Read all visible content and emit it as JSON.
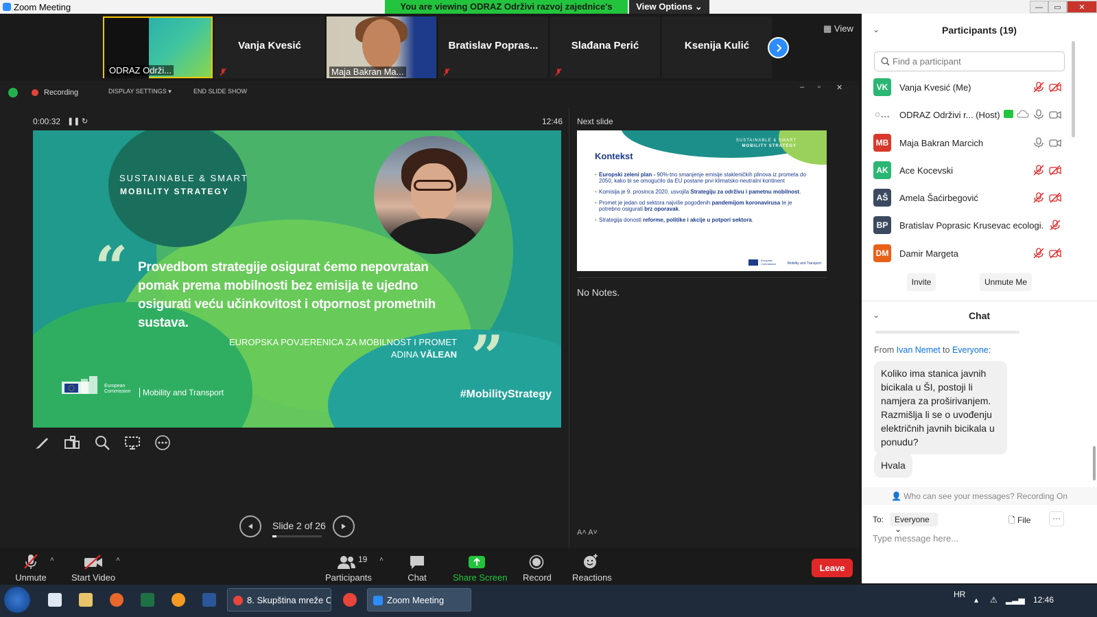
{
  "window": {
    "title": "Zoom Meeting",
    "viewing_banner": "You are viewing ODRAZ Održivi razvoj zajednice's screen",
    "view_options": "View Options ⌄",
    "controls": [
      "—",
      "▭",
      "✕"
    ]
  },
  "thumbnails": [
    {
      "name": "",
      "label": "ODRAZ Održi...",
      "active": true
    },
    {
      "name": "Vanja Kvesić",
      "label": ""
    },
    {
      "name": "",
      "label": "Maja Bakran Ma..."
    },
    {
      "name": "Bratislav  Popras...",
      "label": ""
    },
    {
      "name": "Slađana Perić",
      "label": ""
    },
    {
      "name": "Ksenija Kulić",
      "label": ""
    }
  ],
  "view_button": "View",
  "presenter": {
    "recording": "Recording",
    "display_settings": "DISPLAY SETTINGS ▾",
    "end_slide_show": "END SLIDE SHOW",
    "elapsed": "0:00:32",
    "clock": "12:46",
    "next_slide_label": "Next slide",
    "notes": "No Notes.",
    "font_controls": "A˄  A˅"
  },
  "slide": {
    "title_line1": "SUSTAINABLE & SMART",
    "title_line2": "MOBILITY STRATEGY",
    "quote": "Provedbom strategije osigurat ćemo nepovratan pomak prema mobilnosti bez emisija te ujedno osigurati veću učinkovitost i otpornost prometnih sustava.",
    "attribution_line1": "EUROPSKA POVJERENICA ZA MOBILNOST I PROMET",
    "attribution_first": "ADINA ",
    "attribution_last": "VĂLEAN",
    "commission_line1": "European",
    "commission_line2": "Commission",
    "mobility_transport": "Mobility and Transport",
    "hashtag": "#MobilityStrategy"
  },
  "next_slide": {
    "brand1": "SUSTAINABLE & SMART",
    "brand2": "MOBILITY STRATEGY",
    "heading": "Kontekst",
    "bullets": [
      {
        "bold": "Europski zeleni plan - ",
        "text": "90%-tno smanjenje emisije stakleničkih plinova iz prometa do 2050, kako bi se omogućilo da EU postane prvi klimatsko-neutralni kontinent"
      },
      {
        "bold": "",
        "text": "Komisija je 9. prosinca 2020. usvojila ",
        "bold2": "Strategiju za održivu i pametnu mobilnost",
        "tail": "."
      },
      {
        "bold": "",
        "text": "Promet je jedan od sektora najviše pogođenih ",
        "bold2": "pandemijom koronavirusa",
        "mid": " te je potrebno osigurati ",
        "bold3": "brz oporavak",
        "tail": "."
      },
      {
        "bold": "",
        "text": "Strategija donosti ",
        "bold2": "reforme, politike i akcije u potpori sektora",
        "tail": "."
      }
    ],
    "footer_ec": "European Commission",
    "footer_mt": "Mobility and Transport"
  },
  "slide_nav": {
    "label": "Slide 2 of 26",
    "current": 2,
    "total": 26
  },
  "toolbar": {
    "unmute": "Unmute",
    "start_video": "Start Video",
    "participants": "Participants",
    "participant_count": "19",
    "chat": "Chat",
    "share_screen": "Share Screen",
    "record": "Record",
    "reactions": "Reactions",
    "leave": "Leave"
  },
  "participants_panel": {
    "title": "Participants (19)",
    "search_placeholder": "Find a participant",
    "people": [
      {
        "initials": "VK",
        "name": "Vanja Kvesić (Me)",
        "color": "#2bb673",
        "mic": "muted",
        "video": "off"
      },
      {
        "initials": "",
        "name": "ODRAZ Održivi r... (Host)",
        "color": "",
        "mic": "on",
        "video": "on"
      },
      {
        "initials": "MB",
        "name": "Maja Bakran Marcich",
        "color": "#d9382c",
        "mic": "on",
        "video": "on"
      },
      {
        "initials": "AK",
        "name": "Ace Kocevski",
        "color": "#2bb673",
        "mic": "muted",
        "video": "off"
      },
      {
        "initials": "AŠ",
        "name": "Amela Šaćirbegović",
        "color": "#3b4a5f",
        "mic": "muted",
        "video": "off"
      },
      {
        "initials": "BP",
        "name": "Bratislav Poprasic Krusevac ecologi...",
        "color": "#3b4a5f",
        "mic": "muted",
        "video": "none"
      },
      {
        "initials": "DM",
        "name": "Damir Margeta",
        "color": "#e86118",
        "mic": "muted",
        "video": "off"
      }
    ],
    "invite": "Invite",
    "unmute_me": "Unmute Me"
  },
  "chat_panel": {
    "title": "Chat",
    "from_prefix": "From ",
    "from_name": "Ivan Nemet",
    "to_word": " to ",
    "to_name": "Everyone",
    "to_suffix": ":",
    "messages": [
      "Koliko ima stanica javnih bicikala u ŠI, postoji li namjera za proširivanjem. Razmišlja li se o uvođenju električnih javnih bicikala u ponudu?",
      "Hvala"
    ],
    "visibility_note": "Who can see your messages? Recording On",
    "to_label": "To:",
    "to_select": "Everyone ⌄",
    "file": "File",
    "more": "···",
    "input_placeholder": "Type message here..."
  },
  "taskbar": {
    "task1": "8. Skupština mreže C...",
    "task2": "Zoom Meeting",
    "lang": "HR",
    "time": "12:46"
  },
  "colors": {
    "zoom_blue": "#2d8cff",
    "share_green": "#23c43d",
    "leave_red": "#e02828",
    "slide_teal": "#1f9a8c"
  }
}
